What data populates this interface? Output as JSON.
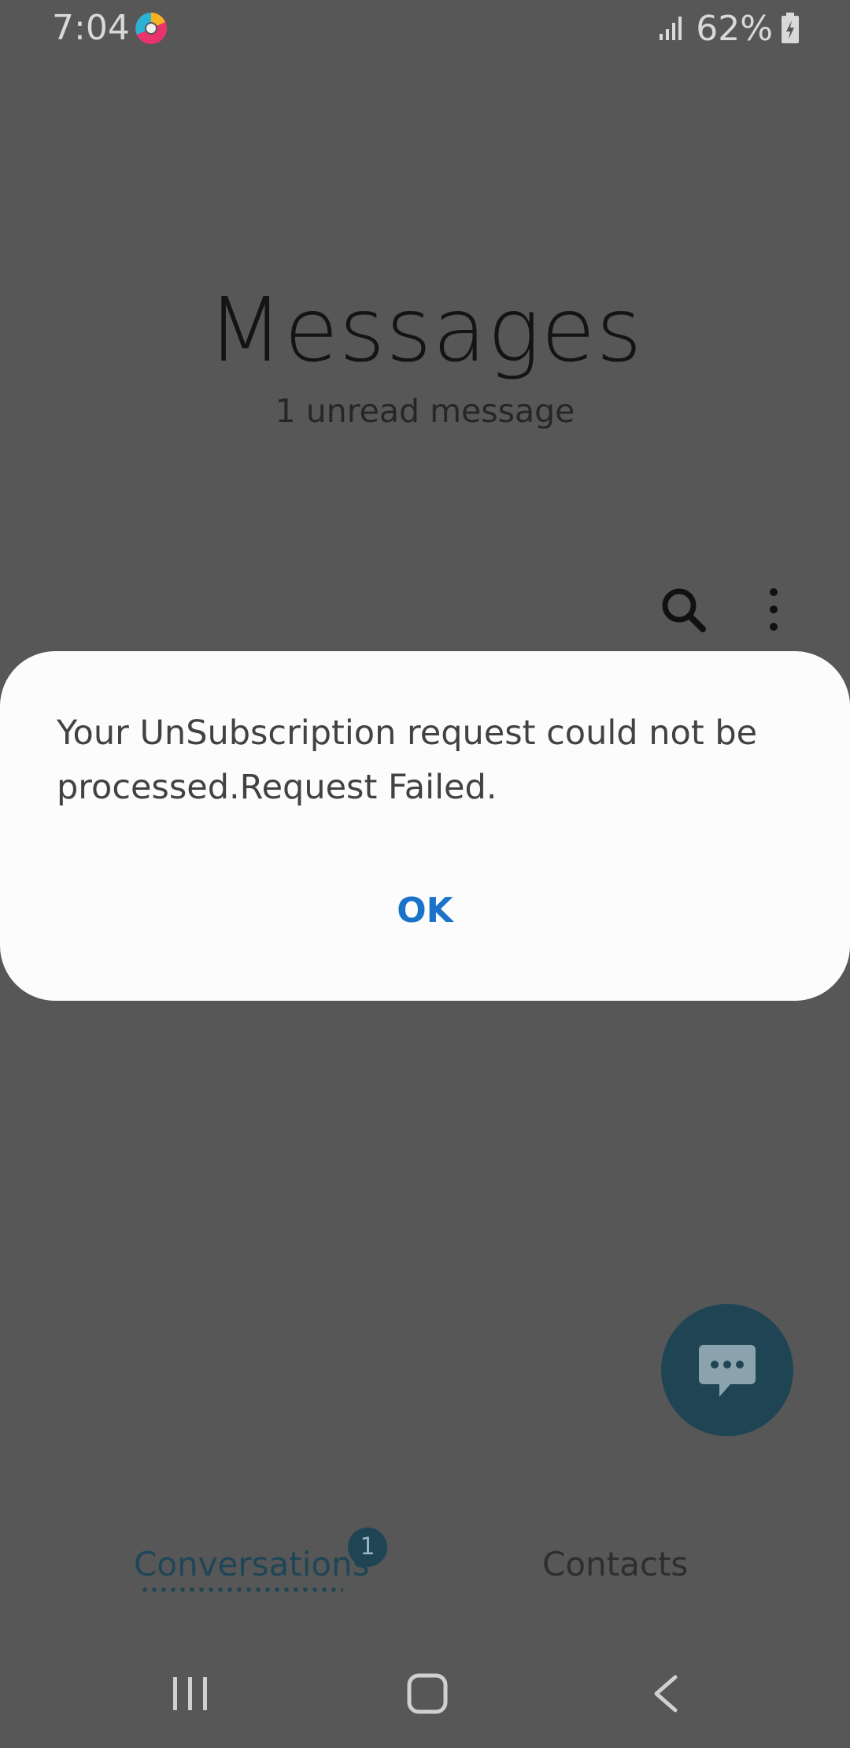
{
  "status_bar": {
    "time": "7:04",
    "app_icon": "browser-app-icon",
    "battery": "62%",
    "signal_icon": "signal-icon",
    "battery_icon": "battery-charging-icon"
  },
  "header": {
    "title": "Messages",
    "subtitle": "1 unread message"
  },
  "toolbar": {
    "search_icon": "search-icon",
    "more_icon": "more-vert-icon"
  },
  "dialog": {
    "message": "Your UnSubscription request could not be processed.Request Failed.",
    "ok_label": "OK"
  },
  "fab": {
    "icon": "compose-message-icon"
  },
  "tabs": {
    "conversations_label": "Conversations",
    "conversations_badge": "1",
    "contacts_label": "Contacts",
    "active": "Conversations"
  },
  "nav_bar": {
    "recents_icon": "recents-icon",
    "home_icon": "home-icon",
    "back_icon": "back-icon"
  },
  "colors": {
    "background": "#575757",
    "dialog_background": "#fcfcfc",
    "accent": "#1a73c9",
    "fab": "#1f4555"
  }
}
